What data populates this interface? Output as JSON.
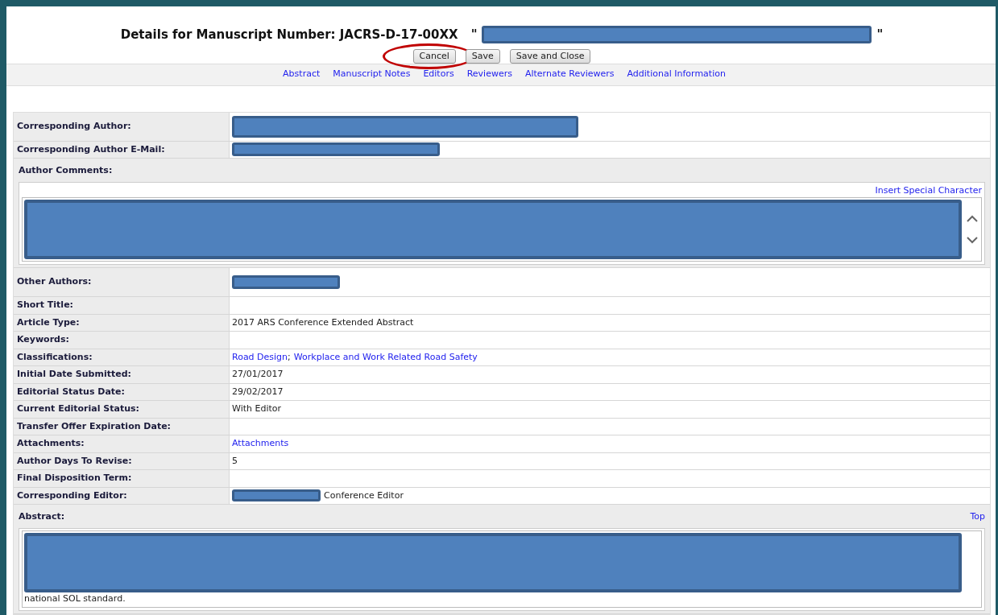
{
  "title": {
    "text": "Details for Manuscript Number: JACRS-D-17-00XX",
    "open_quote": "\"",
    "close_quote": "\""
  },
  "buttons": [
    {
      "label": "Cancel",
      "highlighted": true
    },
    {
      "label": "Save",
      "highlighted": false
    },
    {
      "label": "Save and Close",
      "highlighted": false
    }
  ],
  "nav_links": [
    "Abstract",
    "Manuscript Notes",
    "Editors",
    "Reviewers",
    "Alternate Reviewers",
    "Additional Information"
  ],
  "fields": [
    {
      "label": "Corresponding Author:",
      "kind": "redacted"
    },
    {
      "label": "Corresponding Author E-Mail:",
      "kind": "redacted"
    },
    {
      "label": "Author Comments:",
      "kind": "textarea",
      "link": "Insert Special Character"
    },
    {
      "label": "Other Authors:",
      "kind": "redacted"
    },
    {
      "label": "Short Title:",
      "kind": "empty"
    },
    {
      "label": "Article Type:",
      "kind": "text",
      "value": "2017 ARS Conference Extended Abstract"
    },
    {
      "label": "Keywords:",
      "kind": "empty"
    },
    {
      "label": "Classifications:",
      "kind": "links",
      "separator": ";",
      "values": [
        "Road Design",
        "Workplace and Work Related Road Safety"
      ]
    },
    {
      "label": "Initial Date Submitted:",
      "kind": "text",
      "value": "27/01/2017"
    },
    {
      "label": "Editorial Status Date:",
      "kind": "text",
      "value": "29/02/2017"
    },
    {
      "label": "Current Editorial Status:",
      "kind": "text",
      "value": "With Editor"
    },
    {
      "label": "Transfer Offer Expiration Date:",
      "kind": "empty"
    },
    {
      "label": "Attachments:",
      "kind": "link",
      "value": "Attachments"
    },
    {
      "label": "Author Days To Revise:",
      "kind": "text",
      "value": "5"
    },
    {
      "label": "Final Disposition Term:",
      "kind": "empty"
    },
    {
      "label": "Corresponding Editor:",
      "kind": "redacted_text",
      "value": "Conference Editor"
    },
    {
      "label": "Abstract:",
      "kind": "textarea",
      "link": "Top",
      "trailing_text": "national SOL standard."
    }
  ]
}
